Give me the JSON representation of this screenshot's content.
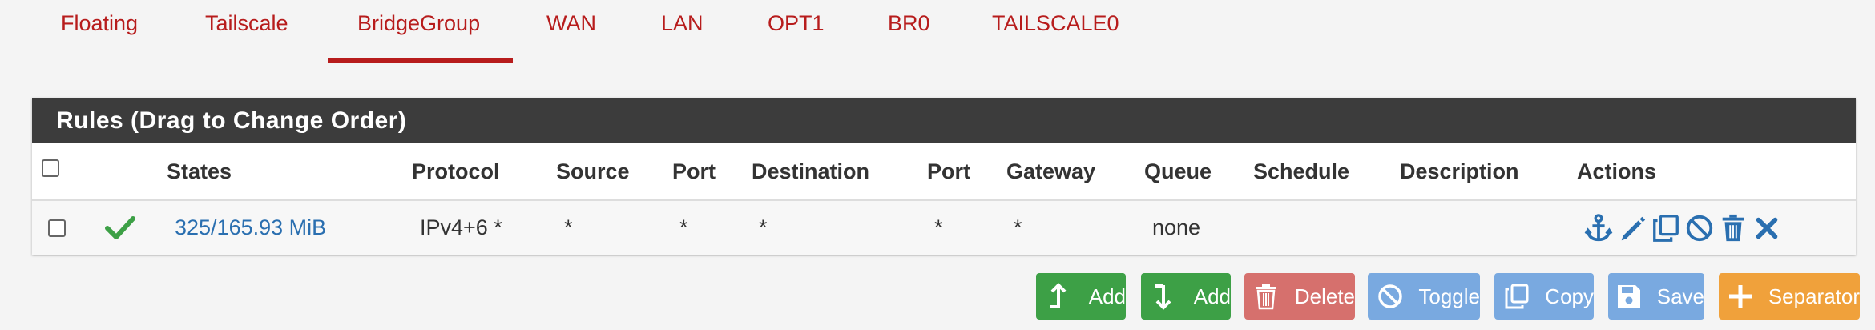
{
  "tabs": [
    {
      "label": "Floating"
    },
    {
      "label": "Tailscale"
    },
    {
      "label": "BridgeGroup"
    },
    {
      "label": "WAN"
    },
    {
      "label": "LAN"
    },
    {
      "label": "OPT1"
    },
    {
      "label": "BR0"
    },
    {
      "label": "TAILSCALE0"
    }
  ],
  "active_tab": "BridgeGroup",
  "panel": {
    "title": "Rules (Drag to Change Order)"
  },
  "columns": {
    "states": "States",
    "protocol": "Protocol",
    "source": "Source",
    "port": "Port",
    "destination": "Destination",
    "port2": "Port",
    "gateway": "Gateway",
    "queue": "Queue",
    "schedule": "Schedule",
    "description": "Description",
    "actions": "Actions"
  },
  "rows": [
    {
      "status_icon": "check-icon",
      "states": "325/165.93 MiB",
      "protocol": "IPv4+6 *",
      "source": "*",
      "port": "*",
      "destination": "*",
      "port2": "*",
      "gateway": "*",
      "queue": "none",
      "schedule": "",
      "description": "",
      "actions": [
        "anchor-icon",
        "pencil-icon",
        "copy-icon",
        "ban-icon",
        "trash-icon",
        "times-icon"
      ]
    }
  ],
  "buttons": {
    "add_top": "Add",
    "add_bottom": "Add",
    "delete": "Delete",
    "toggle": "Toggle",
    "copy": "Copy",
    "save": "Save",
    "separator": "Separator"
  },
  "colors": {
    "tab_text": "#b71c1c",
    "panel_header": "#3c3c3c",
    "link": "#2a6fb0",
    "check": "#3da046",
    "green_button": "#3da046",
    "delete_button": "#d6706d",
    "blue_button": "#79a9e0",
    "separator_button": "#f0a13b"
  }
}
